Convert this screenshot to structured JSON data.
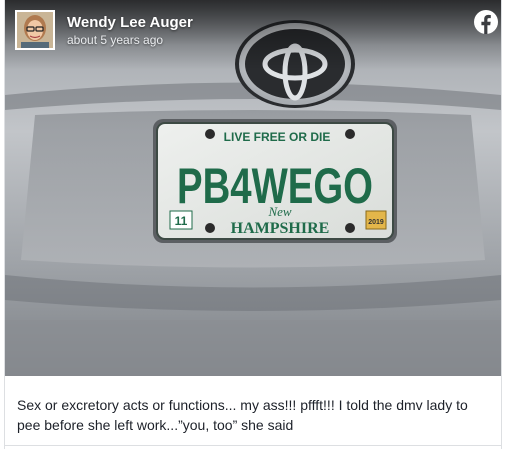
{
  "post": {
    "author": "Wendy Lee Auger",
    "timestamp": "about 5 years ago",
    "caption_line1": "Sex or excretory acts or functions... my ass!!! pffft!!! I told the dmv lady to",
    "caption_line2": "pee before she left work...”you, too” she said"
  },
  "plate": {
    "motto": "LIVE FREE OR DIE",
    "number": "PB4WEGO",
    "month_sticker": "11",
    "script": "New",
    "state": "HAMPSHIRE",
    "year_sticker": "2019"
  },
  "icons": {
    "brand": "facebook-icon",
    "emblem": "toyota-emblem"
  },
  "colors": {
    "plate_green": "#1f6b4a",
    "car_silver": "#9a9ea3",
    "text": "#1d2129"
  }
}
